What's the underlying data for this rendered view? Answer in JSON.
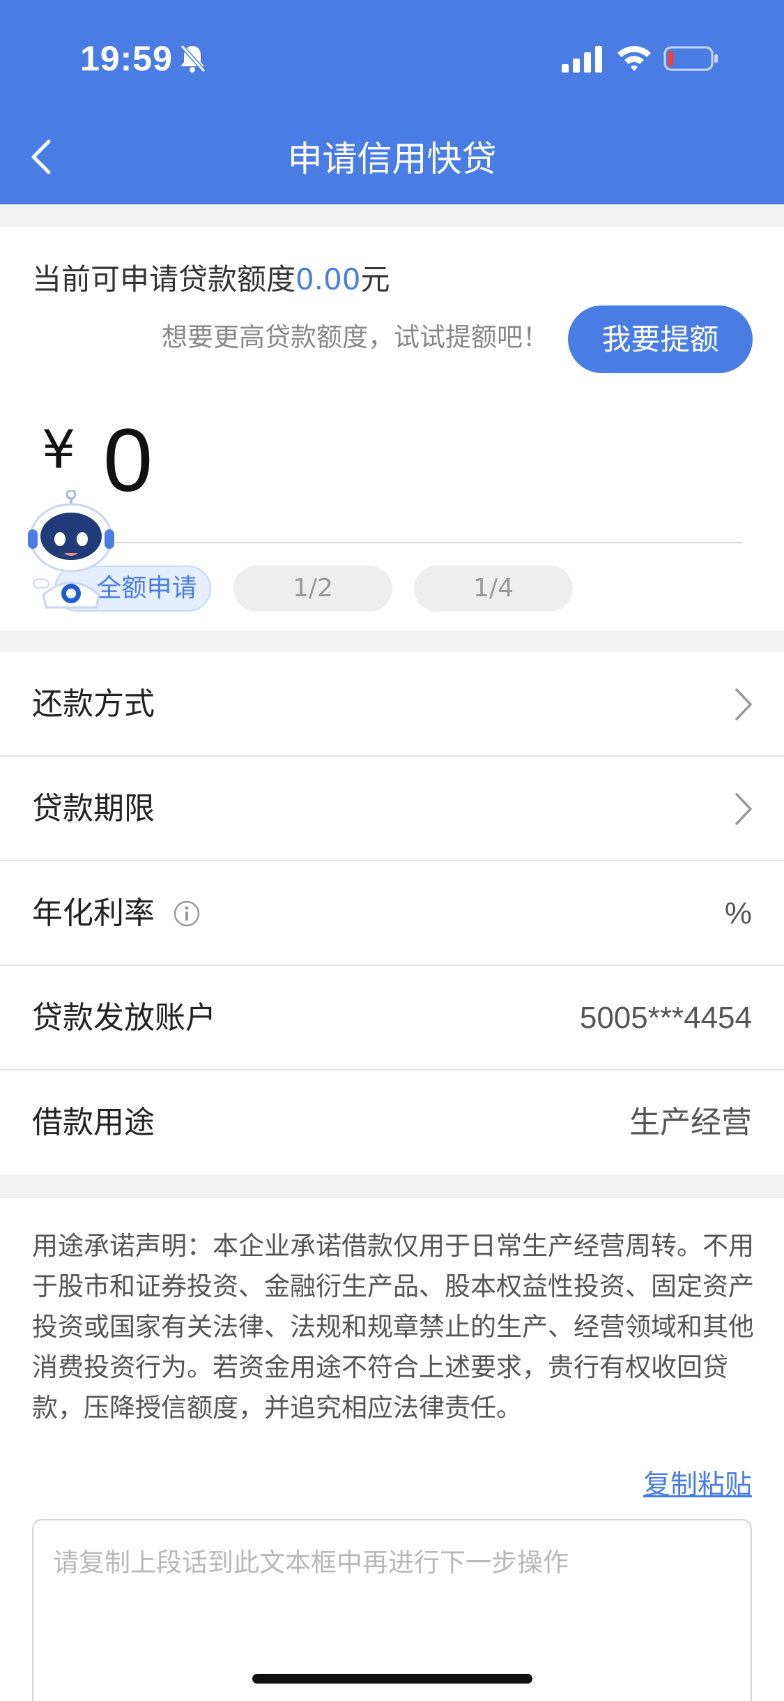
{
  "status_bar": {
    "time": "19:59",
    "icons": [
      "bell-slash-icon",
      "signal-icon",
      "wifi-icon",
      "battery-low-icon"
    ]
  },
  "nav": {
    "title": "申请信用快贷",
    "back_icon": "chevron-left-icon"
  },
  "quota": {
    "prefix": "当前可申请贷款额度",
    "amount": "0.00",
    "unit": "元",
    "hint": "想要更高贷款额度，试试提额吧！",
    "raise_button": "我要提额",
    "currency_symbol": "¥",
    "input_value": "0",
    "options": [
      "全额申请",
      "1/2",
      "1/4"
    ],
    "selected_option": "全额申请"
  },
  "form": {
    "repayment_label": "还款方式",
    "term_label": "贷款期限",
    "rate_label": "年化利率",
    "rate_value": "%",
    "account_label": "贷款发放账户",
    "account_value": "5005***4454",
    "purpose_label": "借款用途",
    "purpose_value": "生产经营"
  },
  "declaration": {
    "text": "用途承诺声明：本企业承诺借款仅用于日常生产经营周转。不用于股市和证券投资、金融衍生产品、股本权益性投资、固定资产投资或国家有关法律、法规和规章禁止的生产、经营领域和其他消费投资行为。若资金用途不符合上述要求，贵行有权收回贷款，压降授信额度，并追究相应法律责任。",
    "copy_link": "复制粘贴",
    "textarea_placeholder": "请复制上段话到此文本框中再进行下一步操作"
  },
  "colors": {
    "brand": "#4a7de3",
    "background": "#f2f2f2",
    "divider": "#e4e4e4"
  }
}
